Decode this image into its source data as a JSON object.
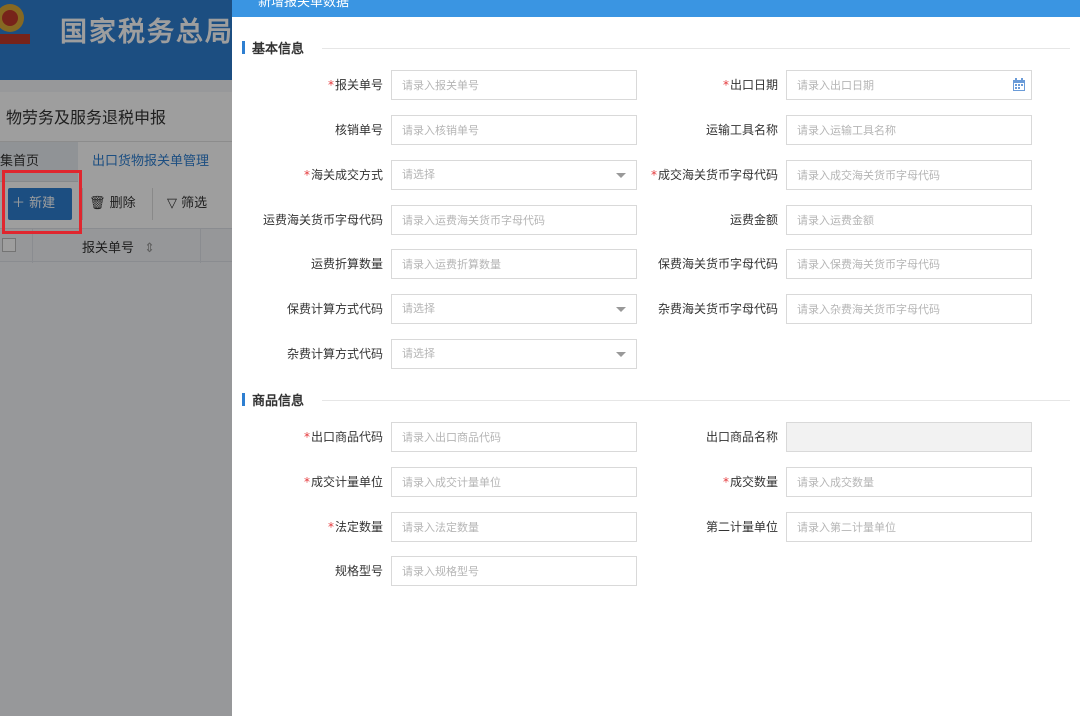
{
  "background": {
    "brand_title": "国家税务总局",
    "page_subtitle": "物劳务及服务退税申报",
    "tabs": {
      "home": "集首页",
      "active": "出口货物报关单管理"
    },
    "toolbar": {
      "new": "新建",
      "delete": "删除",
      "filter": "筛选"
    },
    "table_header": {
      "declaration_no": "报关单号"
    }
  },
  "modal": {
    "title": "新增报关单数据",
    "sections": {
      "basic": "基本信息",
      "goods": "商品信息"
    },
    "basic_fields": {
      "declaration_no": {
        "label": "报关单号",
        "placeholder": "请录入报关单号"
      },
      "export_date": {
        "label": "出口日期",
        "placeholder": "请录入出口日期"
      },
      "verification_no": {
        "label": "核销单号",
        "placeholder": "请录入核销单号"
      },
      "transport_name": {
        "label": "运输工具名称",
        "placeholder": "请录入运输工具名称"
      },
      "transaction_method": {
        "label": "海关成交方式",
        "placeholder": "请选择"
      },
      "transaction_currency": {
        "label": "成交海关货币字母代码",
        "placeholder": "请录入成交海关货币字母代码"
      },
      "freight_currency": {
        "label": "运费海关货币字母代码",
        "placeholder": "请录入运费海关货币字母代码"
      },
      "freight_amount": {
        "label": "运费金额",
        "placeholder": "请录入运费金额"
      },
      "freight_qty": {
        "label": "运费折算数量",
        "placeholder": "请录入运费折算数量"
      },
      "insurance_currency": {
        "label": "保费海关货币字母代码",
        "placeholder": "请录入保费海关货币字母代码"
      },
      "insurance_calc": {
        "label": "保费计算方式代码",
        "placeholder": "请选择"
      },
      "misc_currency": {
        "label": "杂费海关货币字母代码",
        "placeholder": "请录入杂费海关货币字母代码"
      },
      "misc_calc": {
        "label": "杂费计算方式代码",
        "placeholder": "请选择"
      }
    },
    "goods_fields": {
      "goods_code": {
        "label": "出口商品代码",
        "placeholder": "请录入出口商品代码"
      },
      "goods_name": {
        "label": "出口商品名称",
        "placeholder": ""
      },
      "trade_unit": {
        "label": "成交计量单位",
        "placeholder": "请录入成交计量单位"
      },
      "trade_qty": {
        "label": "成交数量",
        "placeholder": "请录入成交数量"
      },
      "legal_qty": {
        "label": "法定数量",
        "placeholder": "请录入法定数量"
      },
      "second_unit": {
        "label": "第二计量单位",
        "placeholder": "请录入第二计量单位"
      },
      "spec_model": {
        "label": "规格型号",
        "placeholder": "请录入规格型号"
      }
    },
    "required_mark": "*"
  },
  "colors": {
    "primary": "#2e7fd1",
    "required": "#e4393c",
    "highlight": "#e0262e"
  }
}
